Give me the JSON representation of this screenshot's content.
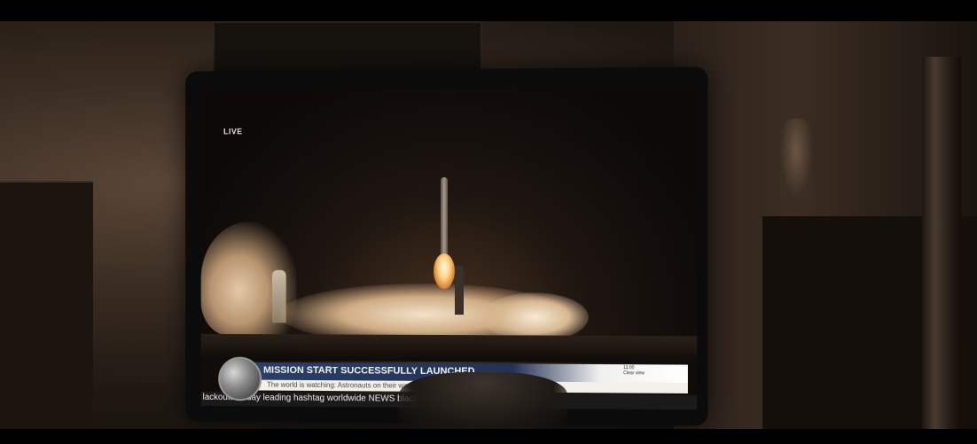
{
  "broadcast": {
    "live_label": "LIVE",
    "headline": "MISSION START SUCCESSFULLY LAUNCHED",
    "subheadline": "The world is watching: Astronauts on their way to new planets.",
    "clock_time": "11:00",
    "clock_caption": "Clear view",
    "crawl_text": "lackouttuesday leading hashtag worldwide    NEWS    blackouttuesday leading hashtag"
  }
}
